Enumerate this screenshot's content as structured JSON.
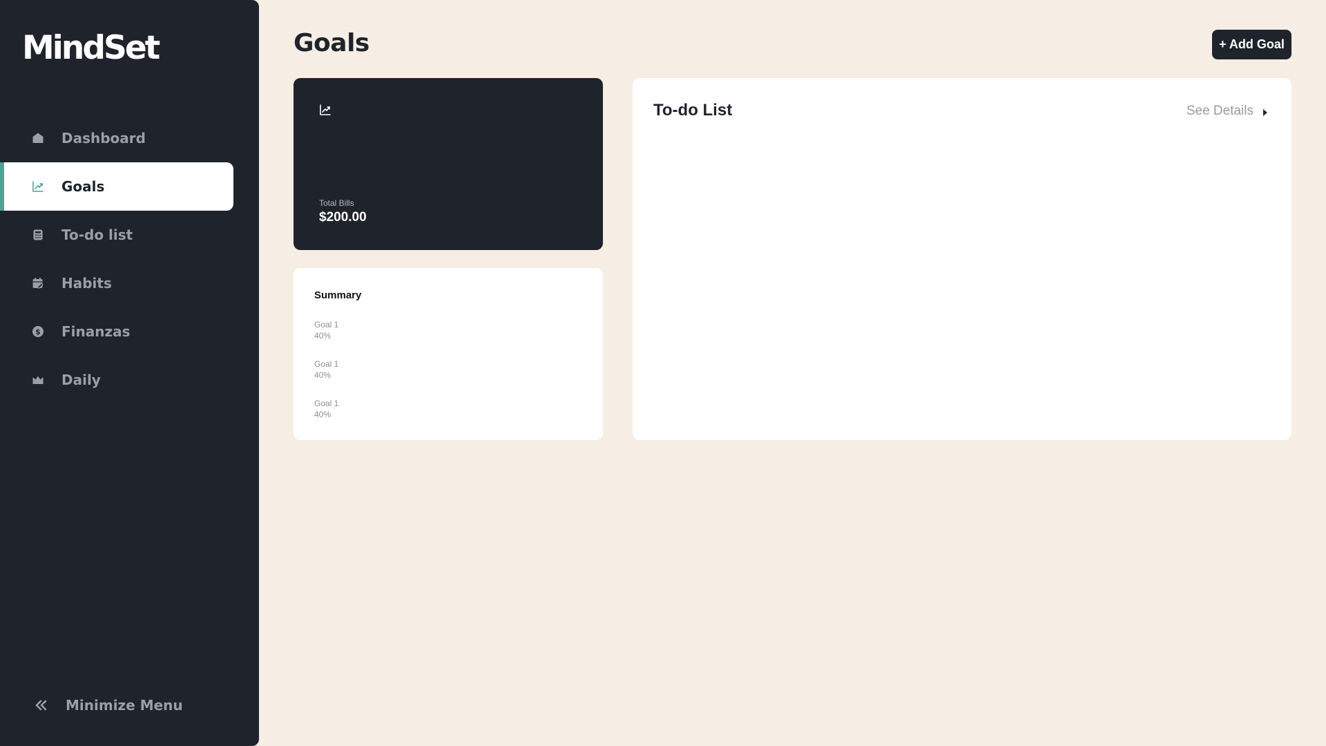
{
  "app": {
    "logo": "MindSet"
  },
  "sidebar": {
    "items": [
      {
        "label": "Dashboard",
        "icon": "home-icon",
        "active": false
      },
      {
        "label": "Goals",
        "icon": "trending-up-icon",
        "active": true
      },
      {
        "label": "To-do list",
        "icon": "calculator-icon",
        "active": false
      },
      {
        "label": "Habits",
        "icon": "calendar-edit-icon",
        "active": false
      },
      {
        "label": "Finanzas",
        "icon": "dollar-circle-icon",
        "active": false
      },
      {
        "label": "Daily",
        "icon": "crown-icon",
        "active": false
      }
    ],
    "minimize_label": "Minimize Menu",
    "minimize_icon": "double-chevron-left-icon"
  },
  "header": {
    "title": "Goals",
    "add_button_label": "+ Add Goal"
  },
  "bills_card": {
    "icon": "trending-up-icon",
    "label": "Total Bills",
    "value": "$200.00"
  },
  "summary": {
    "title": "Summary",
    "goals": [
      {
        "name": "Goal 1",
        "percent": "40%"
      },
      {
        "name": "Goal 1",
        "percent": "40%"
      },
      {
        "name": "Goal 1",
        "percent": "40%"
      }
    ]
  },
  "todo": {
    "title": "To-do List",
    "see_details_label": "See Details",
    "see_details_icon": "caret-right-icon"
  },
  "colors": {
    "background": "#f6eee5",
    "sidebar": "#1f232b",
    "accent": "#4ea493",
    "card": "#ffffff",
    "muted_text": "#9d9fa4"
  }
}
